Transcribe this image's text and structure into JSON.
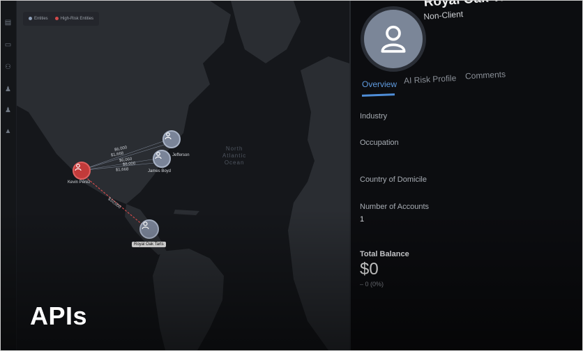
{
  "card": {
    "title": "APIs"
  },
  "map": {
    "legend": [
      {
        "label": "Entities",
        "color": "#8fa0b8"
      },
      {
        "label": "High-Risk Entities",
        "color": "#d24a4a"
      }
    ],
    "ocean_label": "North\nAtlantic\nOcean",
    "nodes": [
      {
        "label": "Kevin Pérez",
        "risk": "high"
      },
      {
        "label": "Jefferson",
        "risk": "normal"
      },
      {
        "label": "James Boyd",
        "risk": "normal"
      },
      {
        "label": "Royal Oak Tarts",
        "risk": "normal"
      }
    ],
    "amounts": [
      "$6,000",
      "$1,668",
      "$6,060",
      "$8,000",
      "$1,668",
      "$10,000"
    ]
  },
  "profile": {
    "name": "Royal Oak Tarts",
    "type": "Non-Client",
    "avatar_icon": "user-icon",
    "tabs": [
      "Overview",
      "AI Risk Profile",
      "Comments"
    ],
    "active_tab": "Overview",
    "fields": {
      "industry_label": "Industry",
      "occupation_label": "Occupation",
      "country_label": "Country of Domicile",
      "accounts_label": "Number of Accounts",
      "accounts_value": "1"
    },
    "total_balance": {
      "label": "Total Balance",
      "value": "$0",
      "change": "– 0 (0%)"
    }
  },
  "colors": {
    "accent": "#4f8ed8",
    "high_risk": "#c23a3a",
    "node": "#7a8498"
  }
}
